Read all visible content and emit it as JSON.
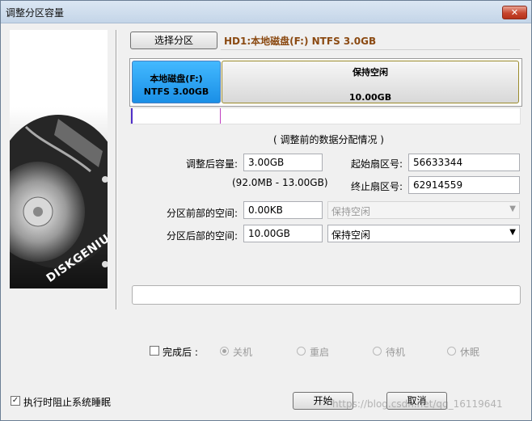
{
  "window": {
    "title": "调整分区容量",
    "close_glyph": "✕"
  },
  "select_partition_button": "选择分区",
  "partition_info": "HD1:本地磁盘(F:) NTFS 3.0GB",
  "partition_map": {
    "current": {
      "name": "本地磁盘(F:)",
      "size": "NTFS 3.00GB"
    },
    "free": {
      "label": "保持空闲",
      "size": "10.00GB"
    }
  },
  "section_title": "( 调整前的数据分配情况 )",
  "form": {
    "new_size_label": "调整后容量:",
    "new_size_value": "3.00GB",
    "size_range": "(92.0MB - 13.00GB)",
    "start_sector_label": "起始扇区号:",
    "start_sector_value": "56633344",
    "end_sector_label": "终止扇区号:",
    "end_sector_value": "62914559",
    "space_before_label": "分区前部的空间:",
    "space_before_value": "0.00KB",
    "space_before_option": "保持空闲",
    "space_after_label": "分区后部的空间:",
    "space_after_value": "10.00GB",
    "space_after_option": "保持空闲"
  },
  "completion": {
    "checkbox_label": "完成后 :",
    "options": [
      "关机",
      "重启",
      "待机",
      "休眠"
    ]
  },
  "prevent_sleep_label": "执行时阻止系统睡眠",
  "buttons": {
    "start": "开始",
    "cancel": "取消"
  },
  "art_text": "DISKGENIUS",
  "watermark": "https://blog.csdn.net/qq_16119641",
  "colors": {
    "selected_partition": "#2aa3f0",
    "free_space": "#e4e4e4",
    "info_text": "#8b4a12"
  }
}
